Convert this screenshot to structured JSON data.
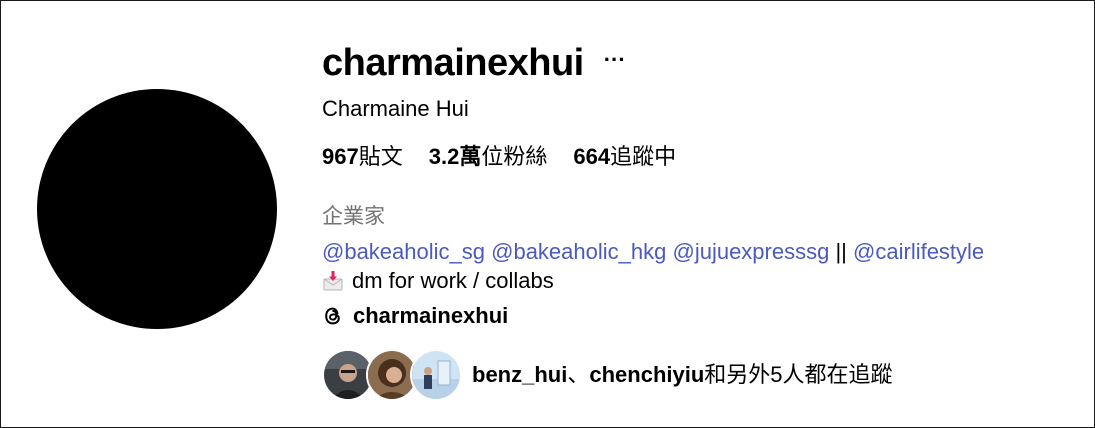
{
  "profile": {
    "username": "charmainexhui",
    "more_label": "···",
    "full_name": "Charmaine Hui",
    "stats": {
      "posts_count": "967",
      "posts_label": "貼文",
      "followers_count": "3.2萬",
      "followers_label": "位粉絲",
      "following_count": "664",
      "following_label": "追蹤中"
    },
    "category": "企業家",
    "bio": {
      "mentions": [
        "@bakeaholic_sg",
        "@bakeaholic_hkg",
        "@jujuexpresssg",
        "@cairlifestyle"
      ],
      "separator": "||",
      "mail_icon": "envelope-incoming-icon",
      "line2": "dm for work / collabs"
    },
    "threads": {
      "icon": "threads-icon",
      "handle": "charmainexhui"
    },
    "followed_by": {
      "user1": "benz_hui",
      "sep": "、",
      "user2": "chenchiyiu",
      "rest": "和另外5人都在追蹤"
    }
  },
  "colors": {
    "link": "#4a5ac2",
    "muted": "#737373",
    "avatar": "#000000"
  }
}
